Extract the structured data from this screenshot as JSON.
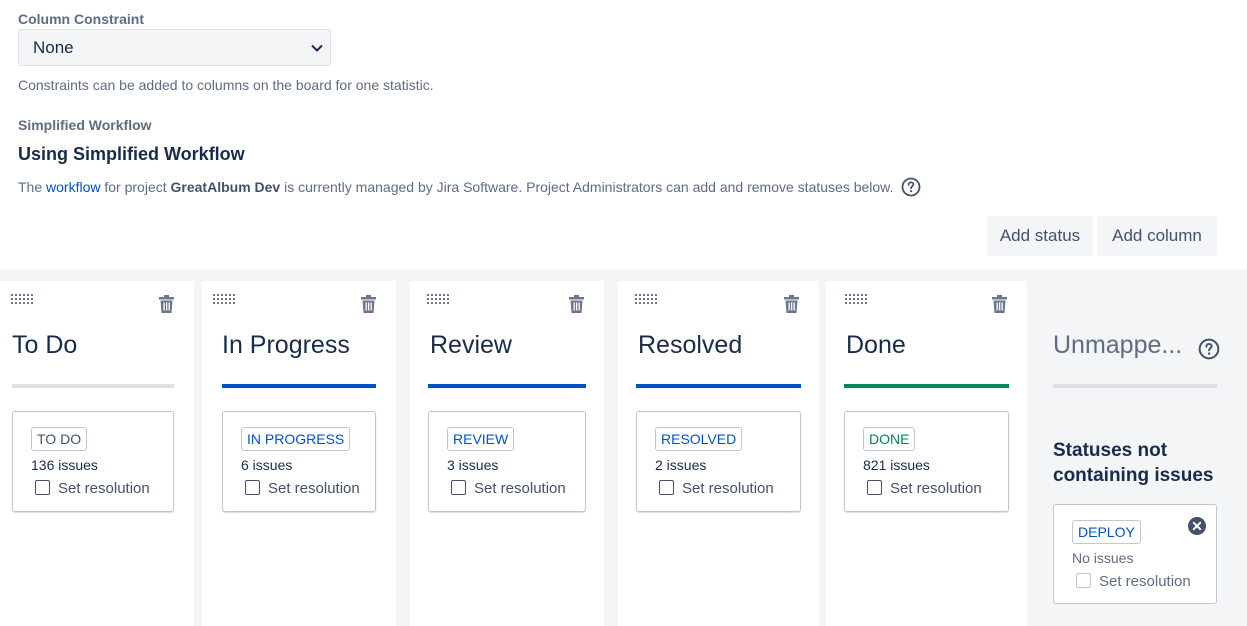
{
  "column_constraint": {
    "label": "Column Constraint",
    "selected": "None",
    "help": "Constraints can be added to columns on the board for one statistic."
  },
  "simplified_workflow": {
    "label": "Simplified Workflow",
    "title": "Using Simplified Workflow",
    "desc_prefix": "The ",
    "desc_link": "workflow",
    "desc_mid": " for project ",
    "desc_project": "GreatAlbum Dev",
    "desc_suffix": " is currently managed by Jira Software. Project Administrators can add and remove statuses below."
  },
  "toolbar": {
    "add_status": "Add status",
    "add_column": "Add column"
  },
  "columns": [
    {
      "title": "To Do",
      "bar_color": "#dfe1e6",
      "status": "TO DO",
      "status_color": "#42526e",
      "count": "136 issues",
      "resolution": "Set resolution"
    },
    {
      "title": "In Progress",
      "bar_color": "#0052cc",
      "status": "IN PROGRESS",
      "status_color": "#0052cc",
      "count": "6 issues",
      "resolution": "Set resolution"
    },
    {
      "title": "Review",
      "bar_color": "#0052cc",
      "status": "REVIEW",
      "status_color": "#0052cc",
      "count": "3 issues",
      "resolution": "Set resolution"
    },
    {
      "title": "Resolved",
      "bar_color": "#0052cc",
      "status": "RESOLVED",
      "status_color": "#0052cc",
      "count": "2 issues",
      "resolution": "Set resolution"
    },
    {
      "title": "Done",
      "bar_color": "#00875a",
      "status": "DONE",
      "status_color": "#00875a",
      "count": "821 issues",
      "resolution": "Set resolution"
    }
  ],
  "unmapped": {
    "title": "Unmappe...",
    "subtitle": "Statuses not containing issues",
    "status": "DEPLOY",
    "status_color": "#0052cc",
    "count": "No issues",
    "resolution": "Set resolution"
  },
  "icons": {
    "chevron": "chevron-down-icon",
    "help": "question-circle-icon",
    "grip": "drag-handle-icon",
    "trash": "trash-icon",
    "close": "close-circle-icon"
  }
}
